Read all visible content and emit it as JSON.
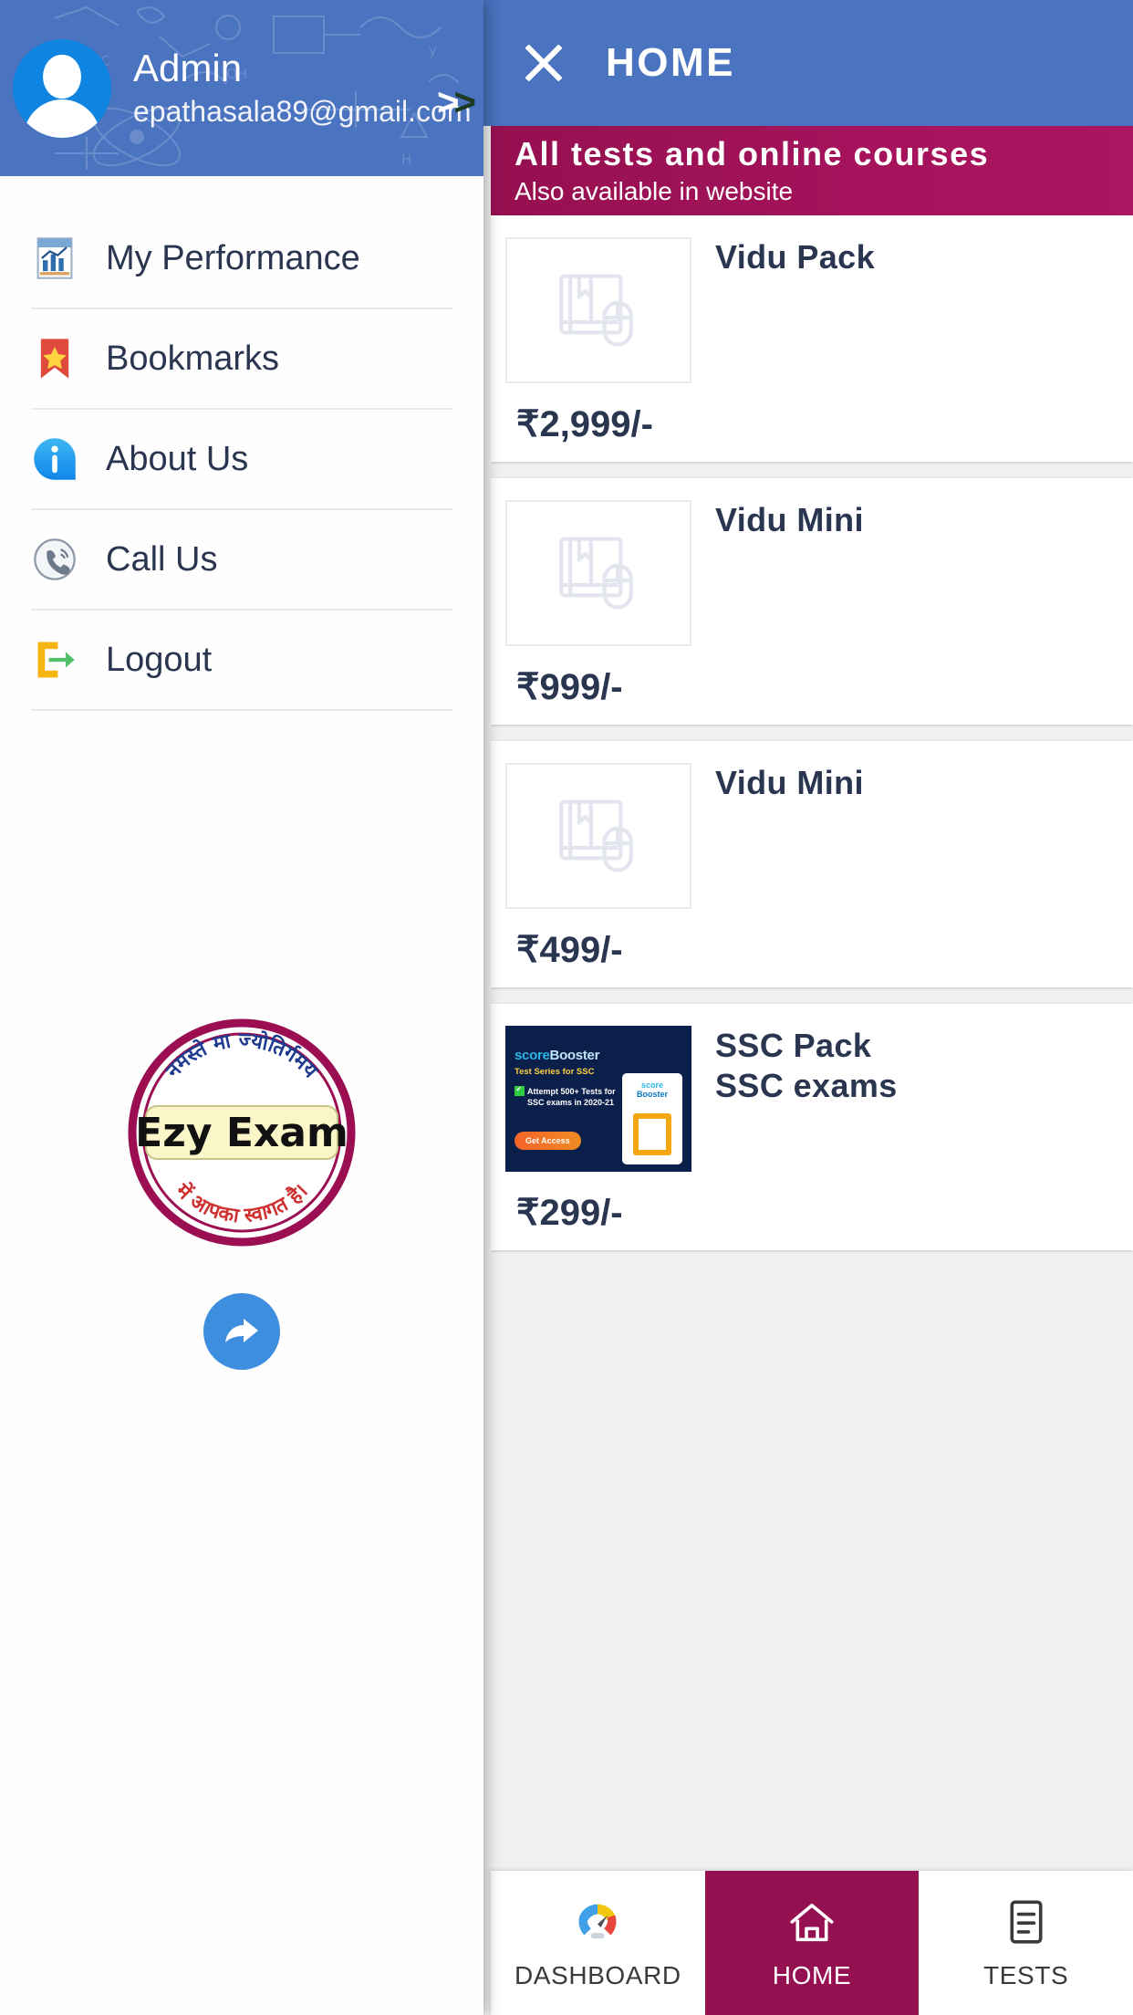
{
  "drawer": {
    "user": {
      "name": "Admin",
      "email": "epathasala89@gmail.com",
      "avatar_icon": "person-avatar-icon",
      "expand_arrow": ">>"
    },
    "menu": [
      {
        "label": "My Performance",
        "icon": "chart-document-icon"
      },
      {
        "label": "Bookmarks",
        "icon": "bookmark-star-icon"
      },
      {
        "label": "About Us",
        "icon": "info-circle-icon"
      },
      {
        "label": "Call Us",
        "icon": "phone-call-icon"
      },
      {
        "label": "Logout",
        "icon": "logout-arrow-icon"
      }
    ],
    "logo": {
      "name": "ezy-exam-logo",
      "center_text": "Ezy Exam",
      "top_arc_text": "नमस्ते मा ज्योतिर्गमय",
      "bottom_arc_text": "में आपका स्वागत है।"
    },
    "share_button": {
      "icon": "share-forward-icon",
      "label": ""
    }
  },
  "home": {
    "appbar": {
      "close_icon": "close-x-icon",
      "title": "HOME"
    },
    "promo": {
      "line1": "All tests and online courses",
      "line2": "Also available in website"
    },
    "products": [
      {
        "title": "Vidu Pack",
        "price": "₹2,999/-",
        "thumb_icon": "book-mouse-placeholder-icon",
        "thumb_type": "placeholder"
      },
      {
        "title": "Vidu Mini",
        "price": "₹999/-",
        "thumb_icon": "book-mouse-placeholder-icon",
        "thumb_type": "placeholder"
      },
      {
        "title": "Vidu Mini",
        "price": "₹499/-",
        "thumb_icon": "book-mouse-placeholder-icon",
        "thumb_type": "placeholder"
      },
      {
        "title": "SSC Pack\nSSC exams",
        "price": "₹299/-",
        "thumb_icon": "score-booster-banner",
        "thumb_type": "banner",
        "banner": {
          "logo_score": "score",
          "logo_booster": "Booster",
          "subtitle": "Test Series for SSC",
          "bullet": "Attempt 500+ Tests for SSC exams in 2020-21",
          "cta": "Get Access",
          "phone_logo_line1": "score",
          "phone_logo_line2": "Booster"
        }
      }
    ],
    "bottom_nav": [
      {
        "label": "DASHBOARD",
        "icon": "gauge-dashboard-icon",
        "active": false
      },
      {
        "label": "HOME",
        "icon": "home-house-icon",
        "active": true
      },
      {
        "label": "TESTS",
        "icon": "tests-icon",
        "active": false
      }
    ]
  },
  "colors": {
    "drawer_header_blue": "#4a73c0",
    "appbar_blue": "#4a73c0",
    "promo_magenta": "#951050",
    "nav_active_magenta": "#951050",
    "avatar_blue": "#0f84e0",
    "text_dark": "#2a3550",
    "fab_blue": "#3e8ee0"
  }
}
